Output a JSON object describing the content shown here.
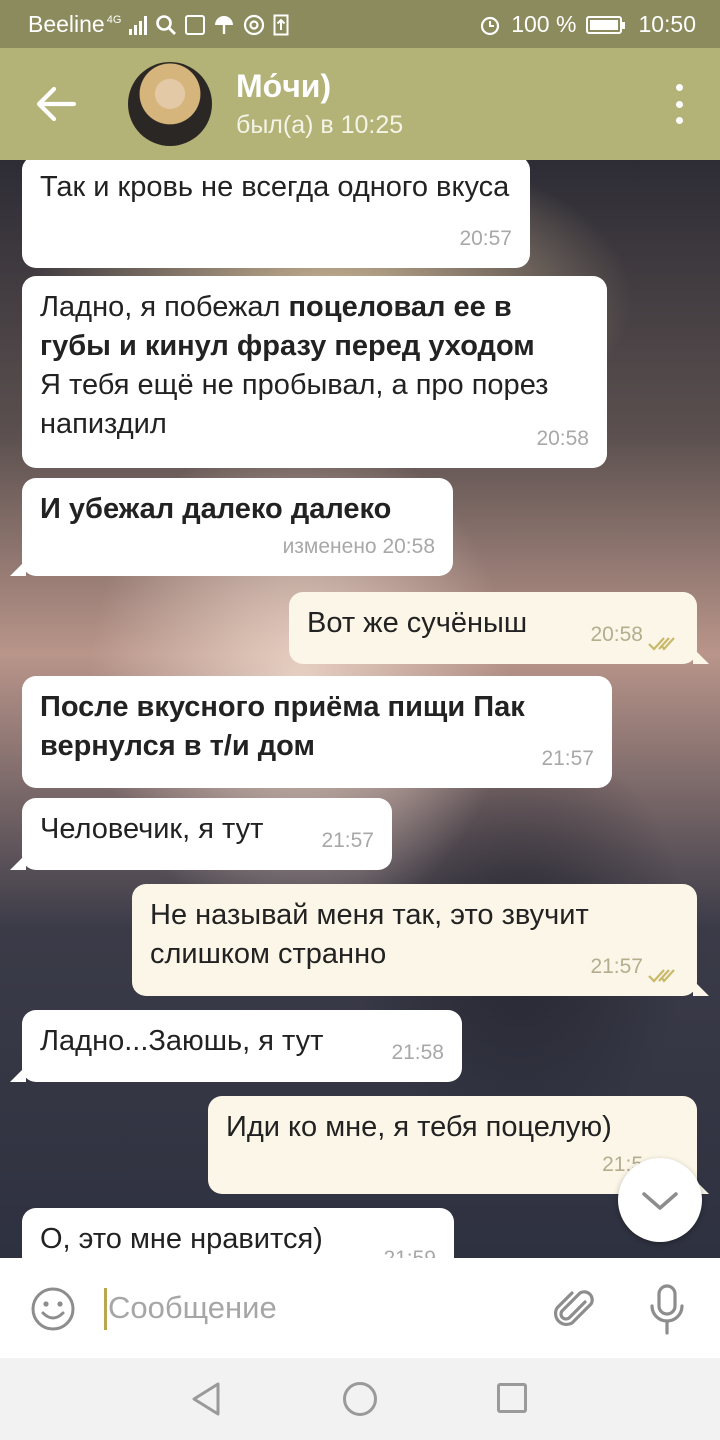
{
  "status_bar": {
    "carrier": "Beeline",
    "network": "4G",
    "battery": "100 %",
    "battery_level": 1.0,
    "time": "10:50",
    "icons": [
      "signal-icon",
      "search-icon",
      "image-icon",
      "umbrella-icon",
      "at-icon",
      "upload-icon",
      "alarm-icon",
      "battery-icon"
    ]
  },
  "header": {
    "contact_name": "Мо́чи)",
    "last_seen": "был(а) в 10:25"
  },
  "messages": [
    {
      "direction": "in",
      "text": "Так и кровь не всегда одного вкуса",
      "time": "20:57"
    },
    {
      "direction": "in",
      "text_plain": "Ладно, я побежал ",
      "text_bold": "поцеловал ее в губы и кинул фразу перед уходом",
      "text_after": "Я тебя ещё не пробывал, а про порез напиздил",
      "time": "20:58"
    },
    {
      "direction": "in",
      "text_bold": "И убежал далеко далеко",
      "time": "изменено 20:58"
    },
    {
      "direction": "out",
      "text": "Вот же сучёныш",
      "time": "20:58",
      "read": true
    },
    {
      "direction": "in",
      "text_bold": "После вкусного приёма пищи Пак вернулся в т/и дом",
      "time": "21:57"
    },
    {
      "direction": "in",
      "text": "Человечик, я тут",
      "time": "21:57"
    },
    {
      "direction": "out",
      "text": "Не называй меня так, это звучит слишком странно",
      "time": "21:57",
      "read": true
    },
    {
      "direction": "in",
      "text": "Ладно...Заюшь, я тут",
      "time": "21:58"
    },
    {
      "direction": "out",
      "text": "Иди ко мне, я тебя поцелую)",
      "time": "21:5",
      "read": true
    },
    {
      "direction": "in",
      "text": "О, это мне нравится)",
      "time": "21:59"
    }
  ],
  "composer": {
    "placeholder": "Сообщение"
  },
  "colors": {
    "header": "#b3b277",
    "status_bar": "#8b8b5d",
    "outgoing_bubble": "#fbf6e7",
    "incoming_bubble": "#ffffff",
    "read_ticks": "#c9b96a"
  }
}
